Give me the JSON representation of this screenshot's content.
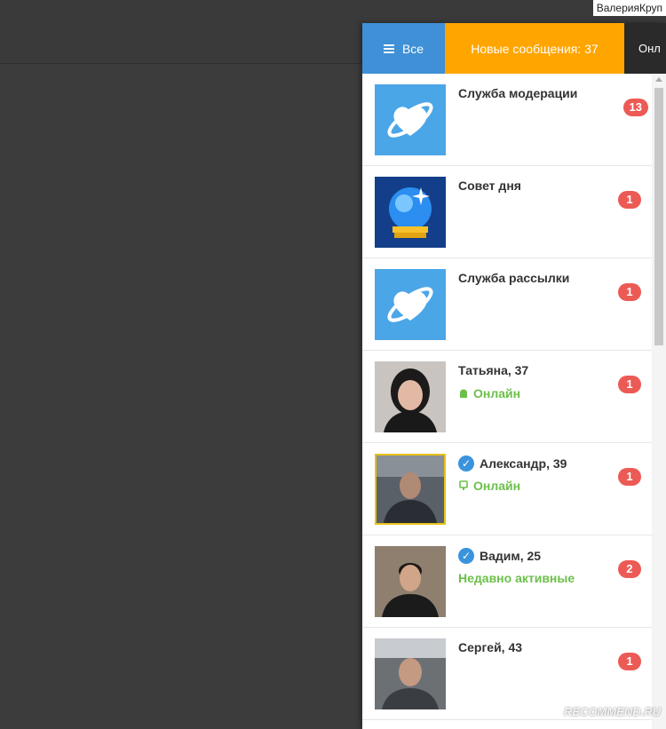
{
  "hint_text": "ВалерияКруп",
  "tabs": {
    "all": "Все",
    "new": "Новые сообщения: 37",
    "online": "Онл"
  },
  "conversations": [
    {
      "name": "Служба модерации",
      "badge": "13",
      "status": "",
      "verified": false,
      "avatar": "heart-planet-logo"
    },
    {
      "name": "Совет дня",
      "badge": "1",
      "status": "",
      "verified": false,
      "avatar": "crystal-ball"
    },
    {
      "name": "Служба рассылки",
      "badge": "1",
      "status": "",
      "verified": false,
      "avatar": "heart-planet-logo"
    },
    {
      "name": "Татьяна, 37",
      "badge": "1",
      "status": "Онлайн",
      "status_icon": "android-icon",
      "verified": false,
      "avatar": "photo-woman"
    },
    {
      "name": "Александр, 39",
      "badge": "1",
      "status": "Онлайн",
      "status_icon": "mobile-icon",
      "verified": true,
      "avatar": "photo-man-car"
    },
    {
      "name": "Вадим, 25",
      "badge": "2",
      "status": "Недавно активные",
      "verified": true,
      "avatar": "photo-man-young"
    },
    {
      "name": "Сергей, 43",
      "badge": "1",
      "status": "",
      "verified": false,
      "avatar": "photo-man-car2"
    }
  ],
  "watermark": "RECOMMEND.RU",
  "colors": {
    "tab_all": "#3f90d6",
    "tab_new": "#ffa500",
    "badge": "#ec5a55",
    "online": "#6cc04a",
    "verified": "#3b93dd"
  }
}
